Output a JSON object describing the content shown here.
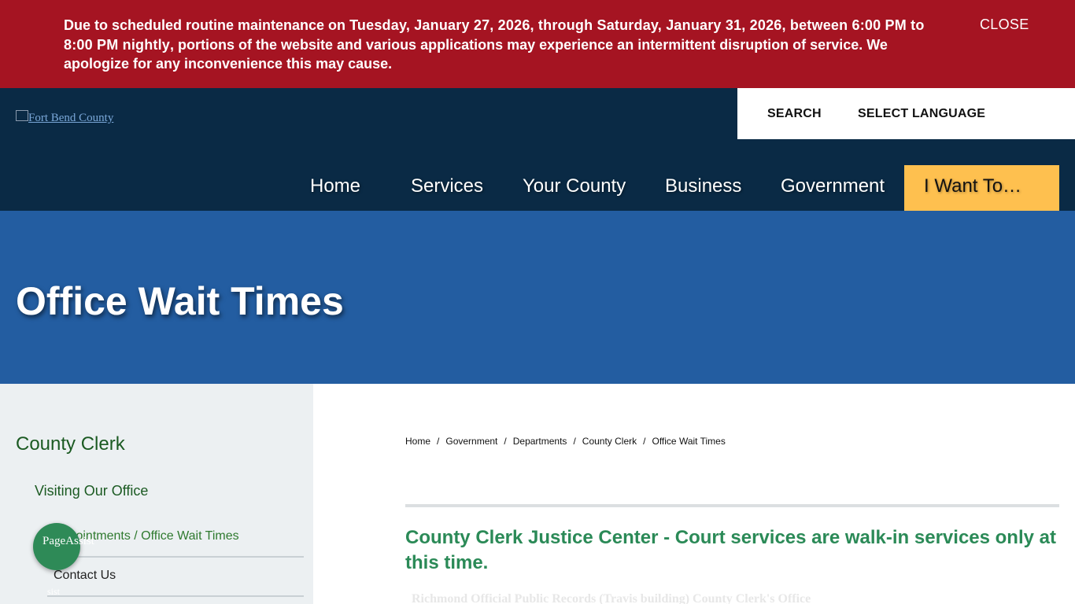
{
  "alert": {
    "text_1": "Due to scheduled routine maintenance on ",
    "text_bold": "Tuesday, January 27, 2026, through Saturday, January 31, 2026, between 6:00 PM to 8:00 PM nightly",
    "text_2": ", portions of the website and various applications may experience an intermittent disruption of service. We apologize for any inconvenience this may cause.",
    "close_label": "CLOSE"
  },
  "header": {
    "logo_alt": "Fort Bend County",
    "search_label": "SEARCH",
    "language_label": "SELECT LANGUAGE"
  },
  "nav": {
    "items": [
      {
        "label": "Home"
      },
      {
        "label": "Services"
      },
      {
        "label": "Your County"
      },
      {
        "label": "Business"
      },
      {
        "label": "Government"
      },
      {
        "label": "I Want To…"
      }
    ]
  },
  "hero": {
    "title": "Office Wait Times"
  },
  "sidebar": {
    "heading": "County Clerk",
    "items": [
      {
        "label": "Visiting Our Office"
      },
      {
        "label": "Appointments / Office Wait Times"
      },
      {
        "label": "Contact Us"
      }
    ],
    "assist_alt": "PageAssist",
    "assist_sub": "sist"
  },
  "breadcrumb": {
    "items": [
      "Home",
      "Government",
      "Departments",
      "County Clerk",
      "Office Wait Times"
    ],
    "separator": "/"
  },
  "main": {
    "heading": "County Clerk Justice Center - Court services are walk-in services only at this time.",
    "faded_text": "Richmond Official Public Records (Travis building) County Clerk's Office"
  },
  "colors": {
    "alert_bg": "#a51422",
    "header_bg": "#0a2a45",
    "hero_bg": "#235da1",
    "cta_bg": "#fec04f",
    "sidebar_bg": "#ecf0f2",
    "heading_green": "#2b8a57"
  }
}
